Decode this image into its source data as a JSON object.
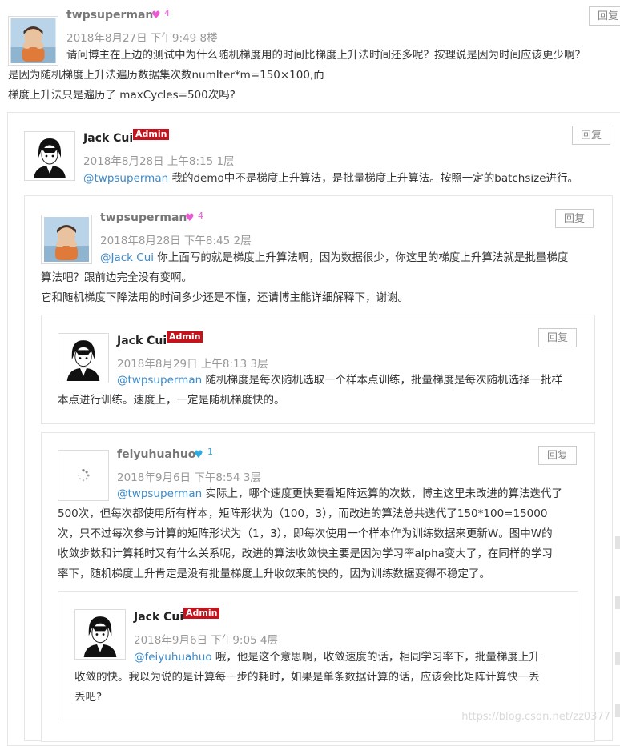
{
  "reply_label": "回复",
  "comments": [
    {
      "name": "twpsuperman",
      "heart_count": "4",
      "meta": "2018年8月27日 下午9:49   8楼",
      "lines": [
        "请问博主在上边的测试中为什么随机梯度用的时间比梯度上升法时间还多呢？按理说是因为时间应该更少啊？",
        "是因为随机梯度上升法遍历数据集次数numIter*m=150×100,而",
        "梯度上升法只是遍历了 maxCycles=500次吗?"
      ]
    },
    {
      "name": "Jack Cui",
      "badge": "Admin",
      "meta": "2018年8月28日 上午8:15   1层",
      "mention": "@twpsuperman",
      "lines": [
        " 我的demo中不是梯度上升算法，是批量梯度上升算法。按照一定的batchsize进行。"
      ]
    },
    {
      "name": "twpsuperman",
      "heart_count": "4",
      "meta": "2018年8月28日 下午8:45   2层",
      "mention": "@Jack Cui",
      "lines": [
        " 你上面写的就是梯度上升算法啊，因为数据很少，你这里的梯度上升算法就是批量梯度",
        "算法吧？跟前边完全没有变啊。",
        "它和随机梯度下降法用的时间多少还是不懂，还请博主能详细解释下，谢谢。"
      ]
    },
    {
      "name": "Jack Cui",
      "badge": "Admin",
      "meta": "2018年8月29日 上午8:13   3层",
      "mention": "@twpsuperman",
      "lines": [
        " 随机梯度是每次随机选取一个样本点训练，批量梯度是每次随机选择一批样",
        "本点进行训练。速度上，一定是随机梯度快的。"
      ]
    },
    {
      "name": "feiyuhuahuo",
      "heart_count": "1",
      "meta": "2018年9月6日 下午8:54   3层",
      "mention": "@twpsuperman",
      "lines": [
        " 实际上，哪个速度更快要看矩阵运算的次数，博主这里未改进的算法迭代了",
        "500次，但每次都使用所有样本，矩阵形状为（100，3），而改进的算法总共迭代了150*100=15000",
        "次，只不过每次参与计算的矩阵形状为（1，3），即每次使用一个样本作为训练数据来更新W。图中W的",
        "收敛步数和计算耗时又有什么关系呢，改进的算法收敛快主要是因为学习率alpha变大了，在同样的学习",
        "率下，随机梯度上升肯定是没有批量梯度上升收敛来的快的，因为训练数据变得不稳定了。"
      ]
    },
    {
      "name": "Jack Cui",
      "badge": "Admin",
      "meta": "2018年9月6日 下午9:05   4层",
      "mention": "@feiyuhuahuo",
      "lines": [
        " 哦，他是这个意思啊，收敛速度的话，相同学习率下，批量梯度上升",
        "收敛的快。我以为说的是计算每一步的耗时，如果是单条数据计算的话，应该会比矩阵计算快一丢",
        "丢吧?"
      ]
    }
  ],
  "watermark": "https://blog.csdn.net/zz0377"
}
